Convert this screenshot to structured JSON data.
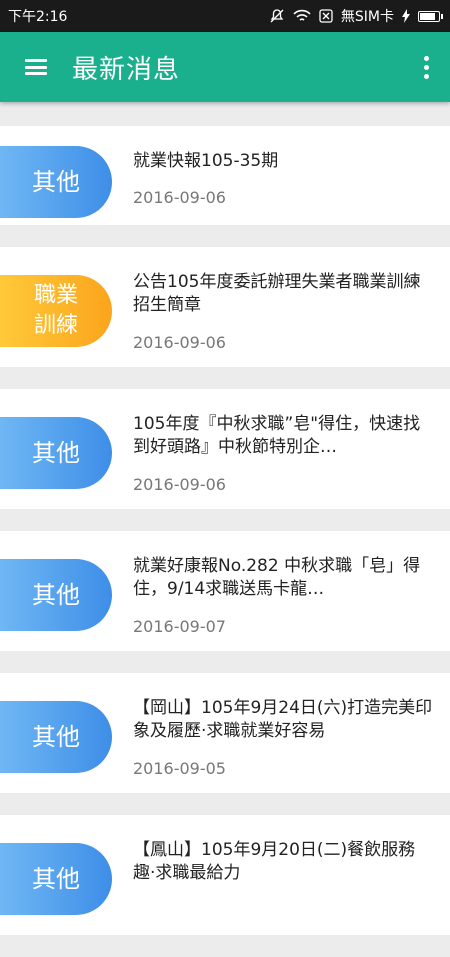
{
  "status_bar": {
    "time": "下午2:16",
    "carrier": "無SIM卡",
    "battery_level": 0.9
  },
  "app_bar": {
    "title": "最新消息",
    "menu_icon": "hamburger-menu-icon",
    "more_icon": "more-vert-icon"
  },
  "colors": {
    "app_bar": "#1aaf8d",
    "badge_blue": "#4a96ea",
    "badge_orange": "#fbb526"
  },
  "news": [
    {
      "category": "其他",
      "color": "blue",
      "title": "就業快報105-35期",
      "date": "2016-09-06"
    },
    {
      "category": "職業\n訓練",
      "color": "orange",
      "title": "公告105年度委託辦理失業者職業訓練招生簡章",
      "date": "2016-09-06"
    },
    {
      "category": "其他",
      "color": "blue",
      "title": "105年度『中秋求職”皂\"得住，快速找到好頭路』中秋節特別企…",
      "date": "2016-09-06"
    },
    {
      "category": "其他",
      "color": "blue",
      "title": "就業好康報No.282 中秋求職「皂」得住，9/14求職送馬卡龍…",
      "date": "2016-09-07"
    },
    {
      "category": "其他",
      "color": "blue",
      "title": "【岡山】105年9月24日(六)打造完美印象及履歷‧求職就業好容易",
      "date": "2016-09-05"
    },
    {
      "category": "其他",
      "color": "blue",
      "title": "【鳳山】105年9月20日(二)餐飲服務趣‧求職最給力",
      "date": ""
    }
  ]
}
